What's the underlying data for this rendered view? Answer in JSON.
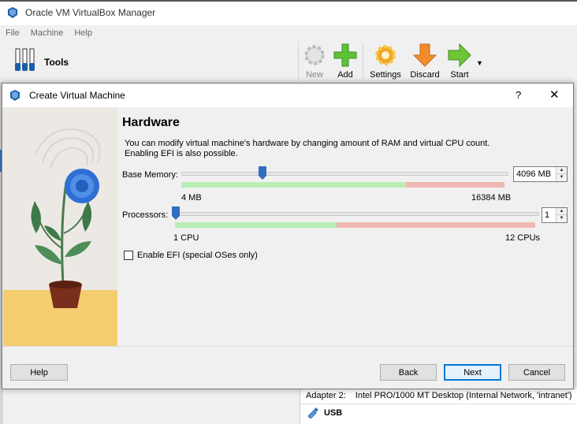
{
  "window": {
    "title": "Oracle VM VirtualBox Manager"
  },
  "menu": [
    "File",
    "Machine",
    "Help"
  ],
  "toolbar": {
    "tools_label": "Tools",
    "new_label": "New",
    "add_label": "Add",
    "settings_label": "Settings",
    "discard_label": "Discard",
    "start_label": "Start"
  },
  "details": {
    "adapter_label": "Adapter 2:",
    "adapter_value": "Intel PRO/1000 MT Desktop (Internal Network, 'intranet')",
    "usb_label": "USB"
  },
  "dialog": {
    "title": "Create Virtual Machine",
    "help_glyph": "?",
    "close_glyph": "✕",
    "heading": "Hardware",
    "description": "You can modify virtual machine's hardware by changing amount of RAM and virtual CPU count. Enabling EFI is also possible.",
    "memory": {
      "label": "Base Memory:",
      "min_label": "4 MB",
      "max_label": "16384 MB",
      "value": "4096 MB",
      "fraction": 0.25
    },
    "processors": {
      "label": "Processors:",
      "min_label": "1 CPU",
      "max_label": "12 CPUs",
      "value": "1",
      "fraction": 0.0
    },
    "efi": {
      "label": "Enable EFI (special OSes only)",
      "checked": false
    },
    "buttons": {
      "help": "Help",
      "back": "Back",
      "next": "Next",
      "cancel": "Cancel"
    }
  },
  "colors": {
    "accent": "#0078d7",
    "slider_thumb": "#2f6fbe",
    "scale_green": "#b9efb5",
    "scale_red": "#f1b9b3"
  }
}
